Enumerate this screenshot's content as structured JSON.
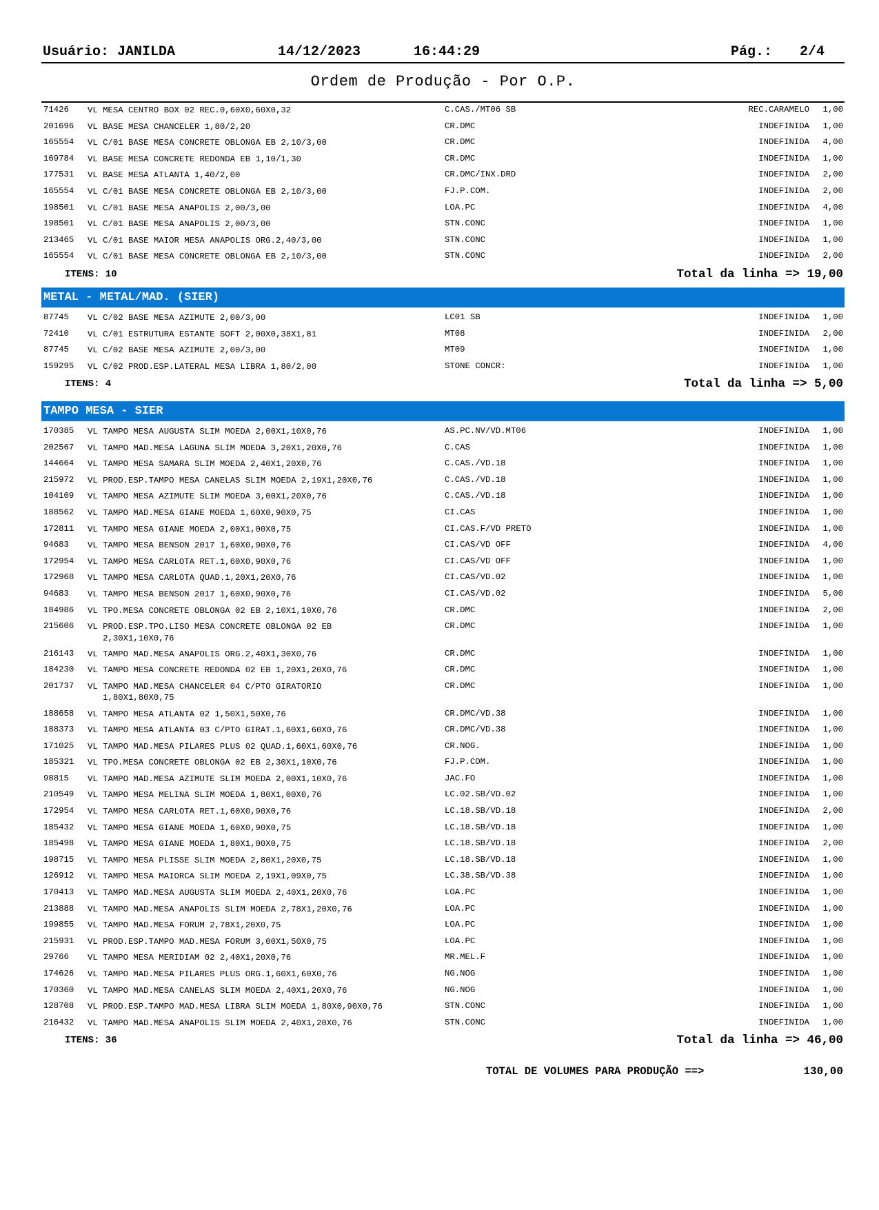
{
  "header": {
    "user": "Usuário: JANILDA",
    "date": "14/12/2023",
    "time": "16:44:29",
    "page_label": "Pág.:",
    "page_value": "2/4"
  },
  "title": "Ordem de Produção - Por O.P.",
  "sections": [
    {
      "heading": "",
      "rows": [
        {
          "code": "71426",
          "desc": "VL MESA CENTRO BOX 02 REC.0,60X0,60X0,32",
          "color": "C.CAS./MT06 SB",
          "status": "REC.CARAMELO",
          "qty": "1,00"
        },
        {
          "code": "201696",
          "desc": "VL BASE MESA CHANCELER 1,80/2,20",
          "color": "CR.DMC",
          "status": "INDEFINIDA",
          "qty": "1,00"
        },
        {
          "code": "165554",
          "desc": "VL C/01 BASE MESA CONCRETE OBLONGA EB 2,10/3,00",
          "color": "CR.DMC",
          "status": "INDEFINIDA",
          "qty": "4,00"
        },
        {
          "code": "169784",
          "desc": "VL BASE MESA CONCRETE REDONDA EB 1,10/1,30",
          "color": "CR.DMC",
          "status": "INDEFINIDA",
          "qty": "1,00"
        },
        {
          "code": "177531",
          "desc": "VL BASE MESA ATLANTA 1,40/2,00",
          "color": "CR.DMC/INX.DRD",
          "status": "INDEFINIDA",
          "qty": "2,00"
        },
        {
          "code": "165554",
          "desc": "VL C/01 BASE MESA CONCRETE OBLONGA EB 2,10/3,00",
          "color": "FJ.P.COM.",
          "status": "INDEFINIDA",
          "qty": "2,00"
        },
        {
          "code": "198501",
          "desc": "VL C/01 BASE MESA ANAPOLIS 2,00/3,00",
          "color": "LOA.PC",
          "status": "INDEFINIDA",
          "qty": "4,00"
        },
        {
          "code": "198501",
          "desc": "VL C/01 BASE MESA ANAPOLIS 2,00/3,00",
          "color": "STN.CONC",
          "status": "INDEFINIDA",
          "qty": "1,00"
        },
        {
          "code": "213465",
          "desc": "VL C/01 BASE MAIOR MESA ANAPOLIS ORG.2,40/3,00",
          "color": "STN.CONC",
          "status": "INDEFINIDA",
          "qty": "1,00"
        },
        {
          "code": "165554",
          "desc": "VL C/01 BASE MESA CONCRETE OBLONGA EB 2,10/3,00",
          "color": "STN.CONC",
          "status": "INDEFINIDA",
          "qty": "2,00"
        }
      ],
      "items_label": "ITENS: 10",
      "total_label": "Total da linha => 19,00"
    },
    {
      "heading": "METAL - METAL/MAD. (SIER)",
      "rows": [
        {
          "code": "87745",
          "desc": "VL C/02 BASE MESA AZIMUTE 2,00/3,00",
          "color": "LC01 SB",
          "status": "INDEFINIDA",
          "qty": "1,00"
        },
        {
          "code": "72410",
          "desc": "VL C/01 ESTRUTURA ESTANTE SOFT 2,00X0,38X1,81",
          "color": "MT08",
          "status": "INDEFINIDA",
          "qty": "2,00"
        },
        {
          "code": "87745",
          "desc": "VL C/02 BASE MESA AZIMUTE 2,00/3,00",
          "color": "MT09",
          "status": "INDEFINIDA",
          "qty": "1,00"
        },
        {
          "code": "159295",
          "desc": "VL C/02 PROD.ESP.LATERAL MESA LIBRA 1,80/2,00",
          "color": "STONE CONCR:",
          "status": "INDEFINIDA",
          "qty": "1,00"
        }
      ],
      "items_label": "ITENS: 4",
      "total_label": "Total da linha => 5,00"
    },
    {
      "heading": "TAMPO MESA - SIER",
      "rows": [
        {
          "code": "170385",
          "desc": "VL TAMPO MESA AUGUSTA SLIM MOEDA 2,00X1,10X0,76",
          "color": "AS.PC.NV/VD.MT06",
          "status": "INDEFINIDA",
          "qty": "1,00"
        },
        {
          "code": "202567",
          "desc": "VL TAMPO MAD.MESA LAGUNA SLIM MOEDA 3,20X1,20X0,76",
          "color": "C.CAS",
          "status": "INDEFINIDA",
          "qty": "1,00"
        },
        {
          "code": "144664",
          "desc": "VL TAMPO MESA SAMARA SLIM MOEDA 2,40X1,20X0,76",
          "color": "C.CAS./VD.18",
          "status": "INDEFINIDA",
          "qty": "1,00"
        },
        {
          "code": "215972",
          "desc": "VL PROD.ESP.TAMPO MESA CANELAS SLIM MOEDA 2,19X1,20X0,76",
          "color": "C.CAS./VD.18",
          "status": "INDEFINIDA",
          "qty": "1,00"
        },
        {
          "code": "104109",
          "desc": "VL TAMPO MESA AZIMUTE SLIM MOEDA 3,00X1,20X0,76",
          "color": "C.CAS./VD.18",
          "status": "INDEFINIDA",
          "qty": "1,00"
        },
        {
          "code": "188562",
          "desc": "VL TAMPO MAD.MESA GIANE MOEDA 1,60X0,90X0,75",
          "color": "CI.CAS",
          "status": "INDEFINIDA",
          "qty": "1,00"
        },
        {
          "code": "172811",
          "desc": "VL TAMPO MESA GIANE MOEDA 2,00X1,00X0,75",
          "color": "CI.CAS.F/VD PRETO",
          "status": "INDEFINIDA",
          "qty": "1,00"
        },
        {
          "code": "94683",
          "desc": "VL TAMPO MESA BENSON 2017 1,60X0,90X0,76",
          "color": "CI.CAS/VD OFF",
          "status": "INDEFINIDA",
          "qty": "4,00"
        },
        {
          "code": "172954",
          "desc": "VL TAMPO MESA CARLOTA RET.1,60X0,90X0,76",
          "color": "CI.CAS/VD OFF",
          "status": "INDEFINIDA",
          "qty": "1,00"
        },
        {
          "code": "172968",
          "desc": "VL TAMPO MESA CARLOTA QUAD.1,20X1,20X0,76",
          "color": "CI.CAS/VD.02",
          "status": "INDEFINIDA",
          "qty": "1,00"
        },
        {
          "code": "94683",
          "desc": "VL TAMPO MESA BENSON 2017 1,60X0,90X0,76",
          "color": "CI.CAS/VD.02",
          "status": "INDEFINIDA",
          "qty": "5,00"
        },
        {
          "code": "184986",
          "desc": "VL TPO.MESA CONCRETE OBLONGA 02 EB 2,10X1,10X0,76",
          "color": "CR.DMC",
          "status": "INDEFINIDA",
          "qty": "2,00"
        },
        {
          "code": "215606",
          "desc": "VL PROD.ESP.TPO.LISO MESA CONCRETE OBLONGA 02 EB\n   2,30X1,10X0,76",
          "color": "CR.DMC",
          "status": "INDEFINIDA",
          "qty": "1,00"
        },
        {
          "code": "216143",
          "desc": "VL TAMPO MAD.MESA ANAPOLIS ORG.2,40X1,30X0,76",
          "color": "CR.DMC",
          "status": "INDEFINIDA",
          "qty": "1,00"
        },
        {
          "code": "184230",
          "desc": "VL TAMPO MESA CONCRETE REDONDA 02 EB 1,20X1,20X0,76",
          "color": "CR.DMC",
          "status": "INDEFINIDA",
          "qty": "1,00"
        },
        {
          "code": "201737",
          "desc": "VL TAMPO MAD.MESA CHANCELER 04 C/PTO GIRATORIO\n   1,80X1,80X0,75",
          "color": "CR.DMC",
          "status": "INDEFINIDA",
          "qty": "1,00"
        },
        {
          "code": "188658",
          "desc": "VL TAMPO MESA ATLANTA 02 1,50X1,50X0,76",
          "color": "CR.DMC/VD.38",
          "status": "INDEFINIDA",
          "qty": "1,00"
        },
        {
          "code": "188373",
          "desc": "VL TAMPO MESA ATLANTA 03 C/PTO GIRAT.1,60X1,60X0,76",
          "color": "CR.DMC/VD.38",
          "status": "INDEFINIDA",
          "qty": "1,00"
        },
        {
          "code": "171025",
          "desc": "VL TAMPO MAD.MESA PILARES PLUS 02 QUAD.1,60X1,60X0,76",
          "color": "CR.NOG.",
          "status": "INDEFINIDA",
          "qty": "1,00"
        },
        {
          "code": "185321",
          "desc": "VL TPO.MESA CONCRETE OBLONGA 02 EB 2,30X1,10X0,76",
          "color": "FJ.P.COM.",
          "status": "INDEFINIDA",
          "qty": "1,00"
        },
        {
          "code": "98815",
          "desc": "VL TAMPO MAD.MESA AZIMUTE SLIM MOEDA 2,00X1,10X0,76",
          "color": "JAC.FO",
          "status": "INDEFINIDA",
          "qty": "1,00"
        },
        {
          "code": "210549",
          "desc": "VL TAMPO MESA MELINA SLIM MOEDA 1,80X1,00X0,76",
          "color": "LC.02.SB/VD.02",
          "status": "INDEFINIDA",
          "qty": "1,00"
        },
        {
          "code": "172954",
          "desc": "VL TAMPO MESA CARLOTA RET.1,60X0,90X0,76",
          "color": "LC.18.SB/VD.18",
          "status": "INDEFINIDA",
          "qty": "2,00"
        },
        {
          "code": "185432",
          "desc": "VL TAMPO MESA GIANE MOEDA 1,60X0,90X0,75",
          "color": "LC.18.SB/VD.18",
          "status": "INDEFINIDA",
          "qty": "1,00"
        },
        {
          "code": "185498",
          "desc": "VL TAMPO MESA GIANE MOEDA 1,80X1,00X0,75",
          "color": "LC.18.SB/VD.18",
          "status": "INDEFINIDA",
          "qty": "2,00"
        },
        {
          "code": "198715",
          "desc": "VL TAMPO MESA PLISSE SLIM MOEDA 2,80X1,20X0,75",
          "color": "LC.18.SB/VD.18",
          "status": "INDEFINIDA",
          "qty": "1,00"
        },
        {
          "code": "126912",
          "desc": "VL TAMPO MESA MAIORCA SLIM MOEDA 2,19X1,09X0,75",
          "color": "LC.38.SB/VD.38",
          "status": "INDEFINIDA",
          "qty": "1,00"
        },
        {
          "code": "170413",
          "desc": "VL TAMPO MAD.MESA AUGUSTA SLIM MOEDA 2,40X1,20X0,76",
          "color": "LOA.PC",
          "status": "INDEFINIDA",
          "qty": "1,00"
        },
        {
          "code": "213888",
          "desc": "VL TAMPO MAD.MESA ANAPOLIS SLIM MOEDA 2,78X1,20X0,76",
          "color": "LOA.PC",
          "status": "INDEFINIDA",
          "qty": "1,00"
        },
        {
          "code": "199855",
          "desc": "VL TAMPO MAD.MESA FORUM 2,78X1,20X0,75",
          "color": "LOA.PC",
          "status": "INDEFINIDA",
          "qty": "1,00"
        },
        {
          "code": "215931",
          "desc": "VL PROD.ESP.TAMPO MAD.MESA FORUM 3,00X1,50X0,75",
          "color": "LOA.PC",
          "status": "INDEFINIDA",
          "qty": "1,00"
        },
        {
          "code": "29766",
          "desc": "VL TAMPO MESA MERIDIAM 02 2,40X1,20X0,76",
          "color": "MR.MEL.F",
          "status": "INDEFINIDA",
          "qty": "1,00"
        },
        {
          "code": "174626",
          "desc": "VL TAMPO MAD.MESA PILARES PLUS ORG.1,60X1,60X0,76",
          "color": "NG.NOG",
          "status": "INDEFINIDA",
          "qty": "1,00"
        },
        {
          "code": "170360",
          "desc": "VL TAMPO MAD.MESA CANELAS SLIM MOEDA 2,40X1,20X0,76",
          "color": "NG.NOG",
          "status": "INDEFINIDA",
          "qty": "1,00"
        },
        {
          "code": "128708",
          "desc": "VL PROD.ESP.TAMPO MAD.MESA LIBRA SLIM MOEDA 1,80X0,90X0,76",
          "color": "STN.CONC",
          "status": "INDEFINIDA",
          "qty": "1,00"
        },
        {
          "code": "216432",
          "desc": "VL TAMPO MAD.MESA ANAPOLIS SLIM MOEDA 2,40X1,20X0,76",
          "color": "STN.CONC",
          "status": "INDEFINIDA",
          "qty": "1,00"
        }
      ],
      "items_label": "ITENS: 36",
      "total_label": "Total da linha => 46,00"
    }
  ],
  "grand_total": {
    "label": "TOTAL DE VOLUMES PARA PRODUÇÃO ==>",
    "value": "130,00"
  },
  "colors": {
    "section_header_bg": "#0878d2",
    "section_header_text": "#ffffff"
  }
}
